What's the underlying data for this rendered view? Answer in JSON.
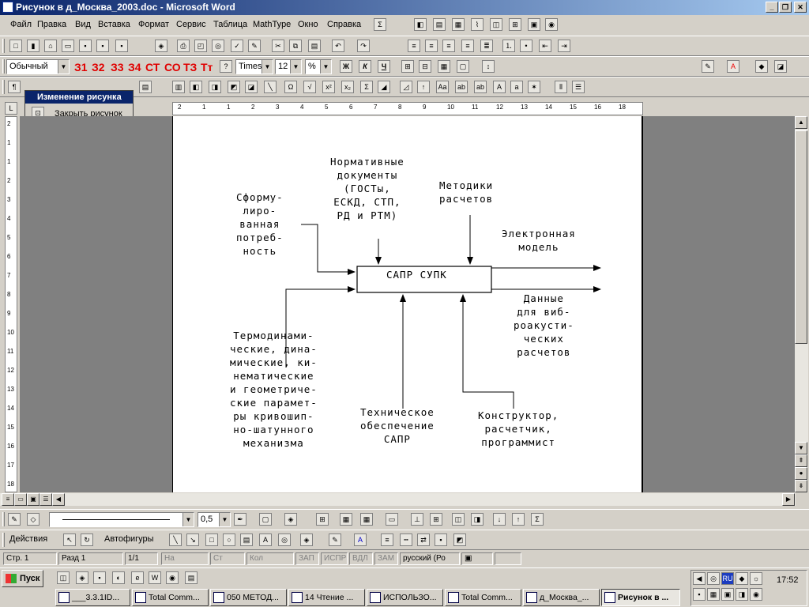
{
  "window": {
    "title": "Рисунок в д_Москва_2003.doc - Microsoft Word"
  },
  "menu": [
    "Файл",
    "Правка",
    "Вид",
    "Вставка",
    "Формат",
    "Сервис",
    "Таблица",
    "MathType",
    "Окно",
    "Справка"
  ],
  "format": {
    "style": "Обычный",
    "font": "Times",
    "size": "12",
    "zoom": "%",
    "bold": "Ж",
    "italic": "К",
    "underline": "Ч"
  },
  "styles_red": [
    "З1",
    "З2",
    "З3",
    "З4",
    "СТ",
    "СО",
    "ТЗ",
    "Тт"
  ],
  "float_panel": {
    "title": "Изменение рисунка",
    "close_label": "Закрыть рисунок"
  },
  "ruler_labels": [
    "2",
    "1",
    "1",
    "2",
    "3",
    "4",
    "5",
    "6",
    "7",
    "8",
    "9",
    "10",
    "11",
    "12",
    "13",
    "14",
    "15",
    "16",
    "18"
  ],
  "ruler_v_labels": [
    "2",
    "1",
    "1",
    "2",
    "3",
    "4",
    "5",
    "6",
    "7",
    "8",
    "9",
    "10",
    "11",
    "12",
    "13",
    "14",
    "15",
    "16",
    "17",
    "18"
  ],
  "diagram": {
    "center": "САПР СУПК",
    "top_left": "Сформу-\nлиро-\nванная\nпотреб-\nность",
    "top_mid": "Нормативные\nдокументы\n(ГОСТы,\nЕСКД, СТП,\nРД и РТМ)",
    "top_right": "Методики\nрасчетов",
    "out1": "Электронная\nмодель",
    "out2": "Данные\nдля виб-\nроакусти-\nческих\nрасчетов",
    "bottom_left": "Термодинами-\nческие, дина-\nмические, ки-\nнематические\nи геометриче-\nские парамет-\nры кривошип-\nно-шатунного\nмеханизма",
    "bottom_mid": "Техническое\nобеспечение\nСАПР",
    "bottom_right": "Конструктор,\nрасчетчик,\nпрограммист"
  },
  "drawing": {
    "line_width": "0,5",
    "actions": "Действия",
    "autoshapes": "Автофигуры"
  },
  "status": {
    "page": "Стр. 1",
    "section": "Разд 1",
    "pages": "1/1",
    "at": "На",
    "ln": "Ст",
    "col": "Кол",
    "rec": "ЗАП",
    "trk": "ИСПР",
    "ext": "ВДЛ",
    "ovr": "ЗАМ",
    "lang": "русский (Ро"
  },
  "taskbar": {
    "start": "Пуск",
    "clock": "17:52",
    "lang": "RU",
    "tasks": [
      "___3.3.1ID...",
      "Total Comm...",
      "050 МЕТОД...",
      "14 Чтение ...",
      "ИСПОЛЬЗО...",
      "Total Comm...",
      "д_Москва_...",
      "Рисунок в ..."
    ]
  }
}
